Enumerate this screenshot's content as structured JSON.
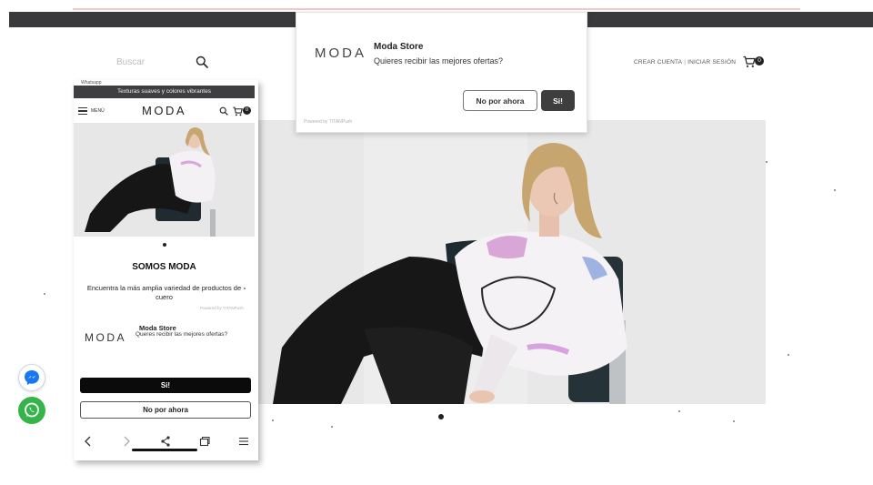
{
  "header": {
    "search_placeholder": "Buscar",
    "create_account": "CREAR CUENTA",
    "separator": "|",
    "login": "INICIAR SESIÓN",
    "cart_count": "0"
  },
  "push_popup": {
    "logo": "MODA",
    "title": "Moda Store",
    "message": "Quieres recibir las mejores ofertas?",
    "no_label": "No por ahora",
    "yes_label": "Si!",
    "powered_by": "Powered by TITANPush"
  },
  "mobile": {
    "status_text": "Whatsapp",
    "banner": "Texturas suaves y colores vibrantes",
    "menu_label": "MENÚ",
    "logo": "MODA",
    "cart_count": "0",
    "heading": "SOMOS MODA",
    "description": "Encuentra la más amplia variedad de productos de cuero",
    "powered_by": "Powered by TITANPush",
    "push": {
      "logo": "MODA",
      "title": "Moda Store",
      "message": "Queres recibir las mejores ofertas?",
      "yes_label": "Si!",
      "no_label": "No por ahora"
    }
  },
  "colors": {
    "top_bar": "#3a3a3c",
    "primary_button": "#3e3e3e",
    "whatsapp": "#35b44a",
    "messenger": "#1877f2"
  },
  "icons": [
    "search-icon",
    "cart-icon",
    "menu-icon",
    "back-icon",
    "forward-icon",
    "share-icon",
    "tabs-icon",
    "more-menu-icon",
    "messenger-icon",
    "whatsapp-icon"
  ]
}
